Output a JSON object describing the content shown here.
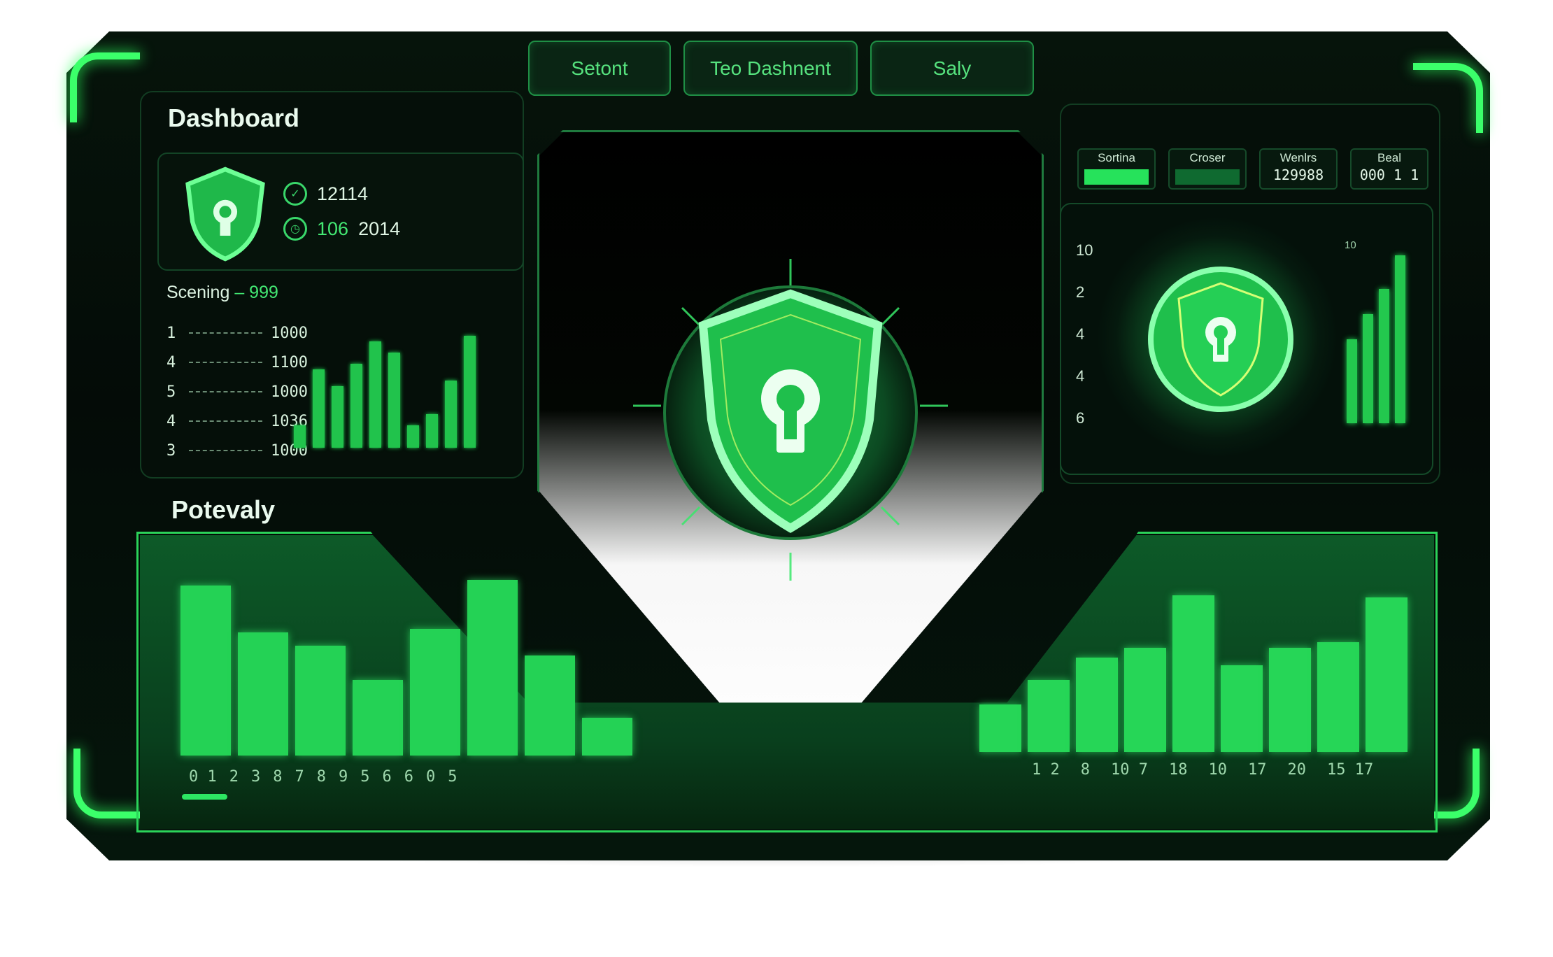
{
  "header": {
    "tabs": [
      {
        "label": "Setont"
      },
      {
        "label": "Teo Dashnent"
      },
      {
        "label": "Saly"
      }
    ]
  },
  "dashboard": {
    "title": "Dashboard",
    "stats": [
      {
        "icon": "check-circle-icon",
        "value": "12114"
      },
      {
        "icon": "clock-icon",
        "prefix": "106",
        "value": "2014"
      }
    ],
    "score_label": "Scening",
    "score_value": "– 999",
    "list": [
      {
        "key": "1",
        "value": "1000"
      },
      {
        "key": "4",
        "value": "1100"
      },
      {
        "key": "5",
        "value": "1000"
      },
      {
        "key": "4",
        "value": "1036"
      },
      {
        "key": "3",
        "value": "1000"
      }
    ],
    "mini_bars": [
      0.2,
      0.7,
      0.55,
      0.75,
      0.95,
      0.85,
      0.2,
      0.3,
      0.6,
      1.0
    ]
  },
  "right_panel": {
    "mini_tabs": [
      {
        "label": "Sortina",
        "value": "",
        "fill": "bright"
      },
      {
        "label": "Croser",
        "value": "",
        "fill": "dim"
      },
      {
        "label": "Wenlrs",
        "value": "129988"
      },
      {
        "label": "Beal",
        "value": "000 1 1"
      }
    ],
    "axis_labels": [
      "10",
      "2",
      "4",
      "4",
      "6"
    ],
    "bar_label": "10",
    "bars": [
      0.5,
      0.65,
      0.8,
      1.0
    ]
  },
  "potevaly": {
    "title": "Potevaly",
    "bars": [
      0.9,
      0.65,
      0.58,
      0.4,
      0.67,
      0.93,
      0.53,
      0.2
    ],
    "ticks": [
      "0 1",
      "2",
      "3",
      "8",
      "7",
      "8",
      "9",
      "5",
      "6",
      "6",
      "0",
      "5"
    ]
  },
  "right_bottom": {
    "bars": [
      0.25,
      0.38,
      0.5,
      0.55,
      0.83,
      0.46,
      0.55,
      0.58,
      0.82
    ],
    "ticks": [
      "1 2",
      "8",
      "10 7",
      "18",
      "10",
      "17",
      "20",
      "15 17"
    ]
  },
  "colors": {
    "accent": "#2be060",
    "background": "#040b07",
    "panel_border": "#123d22"
  }
}
